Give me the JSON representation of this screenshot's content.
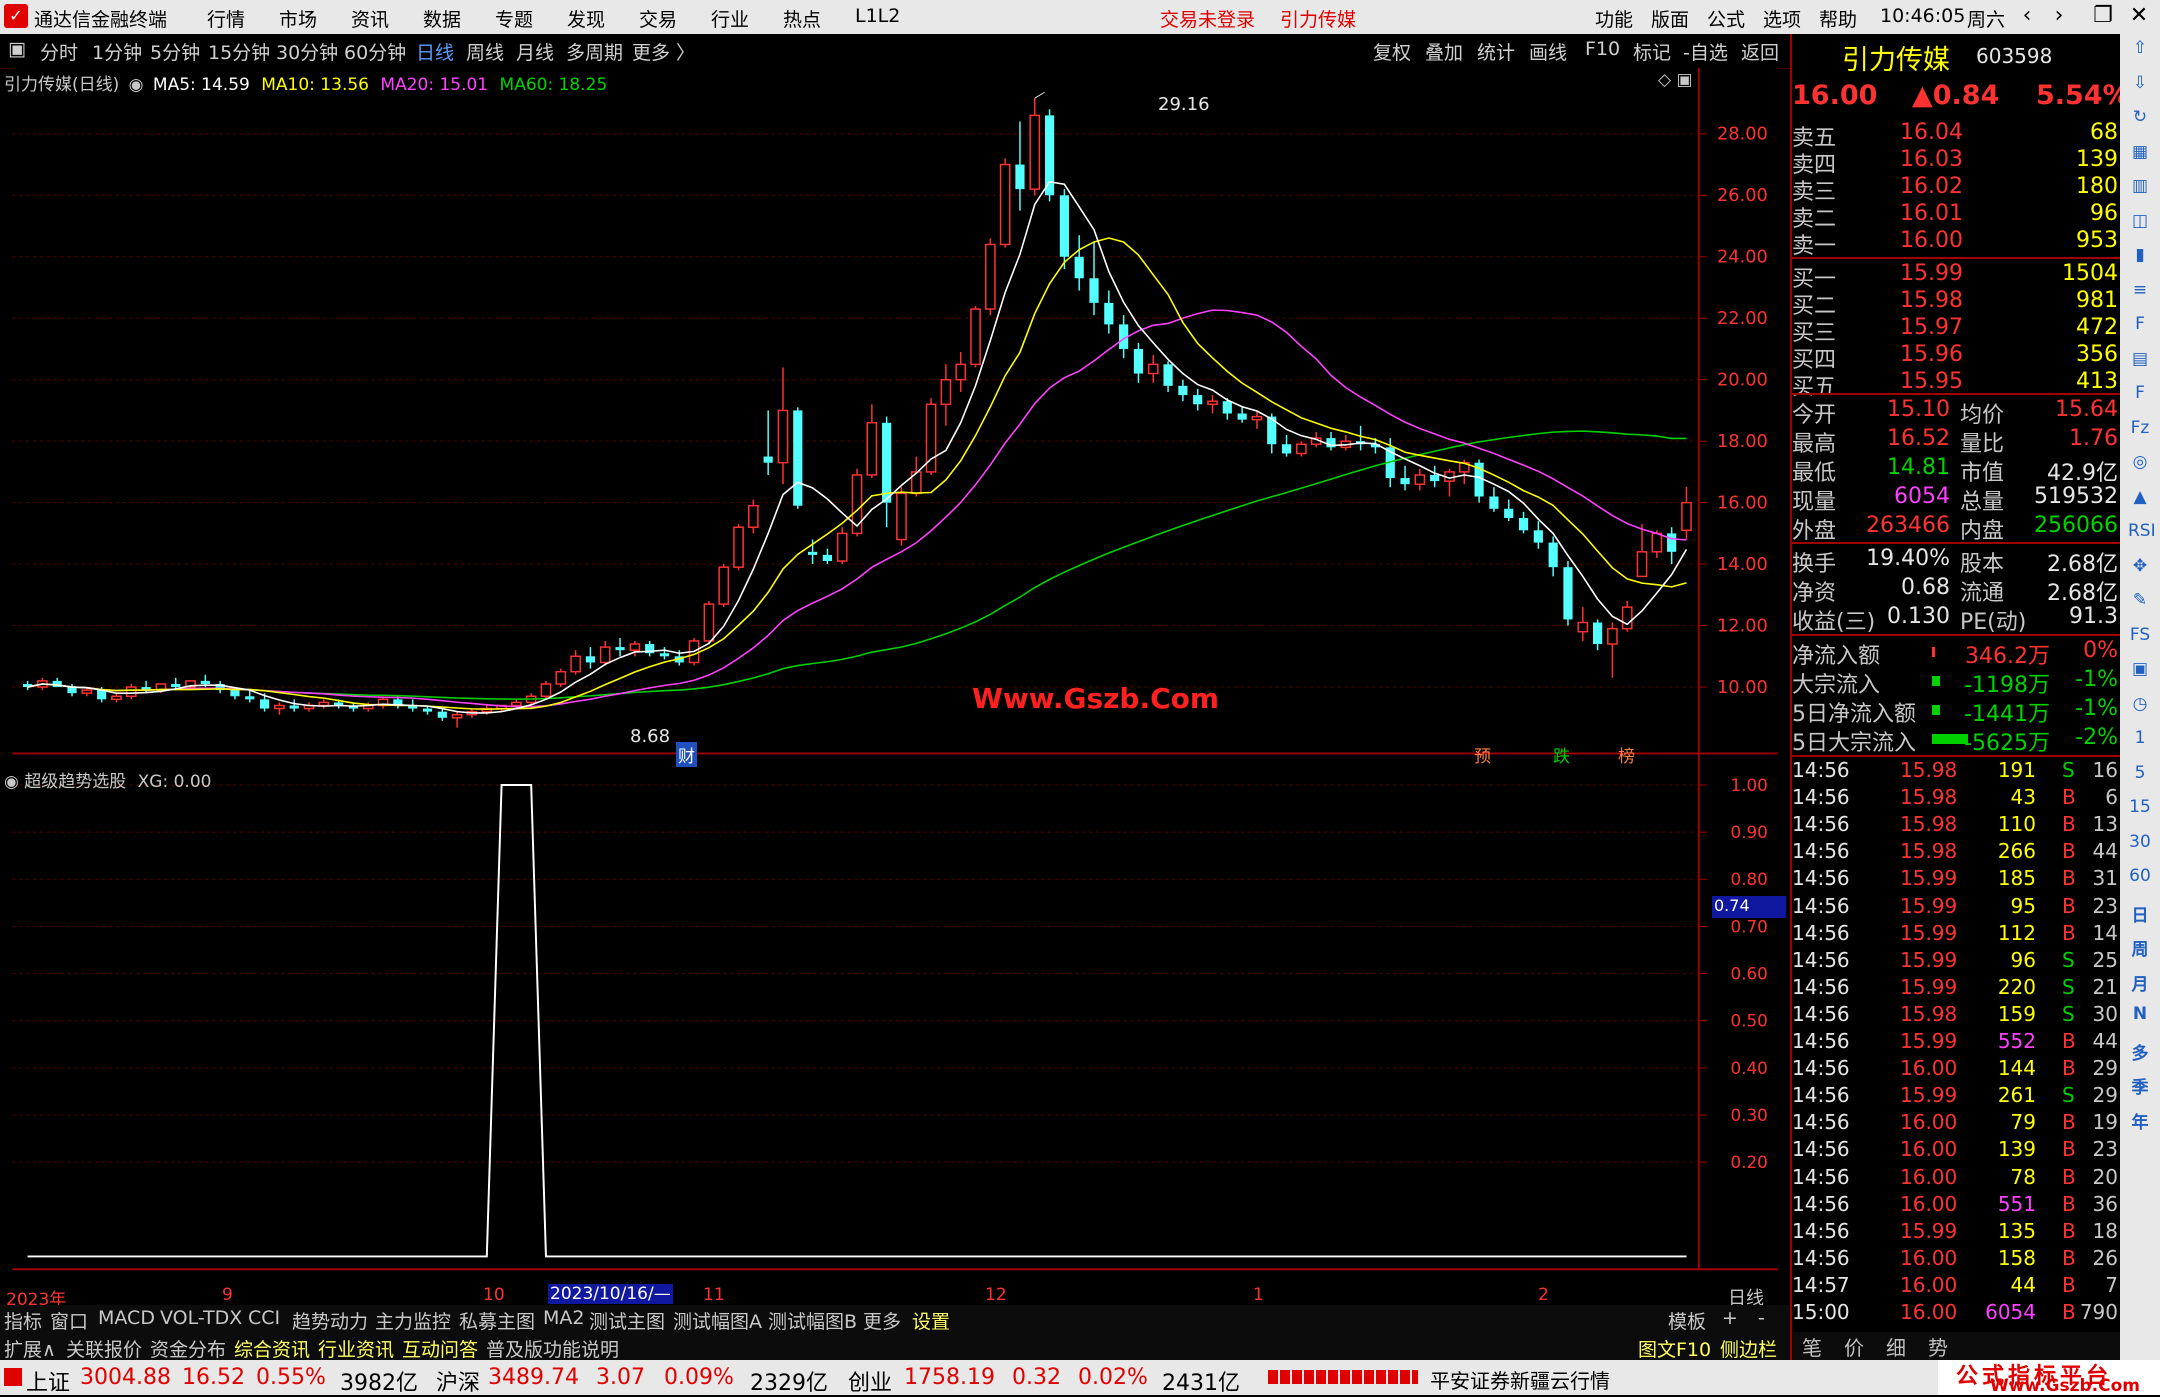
{
  "app": {
    "title": "通达信金融终端",
    "menu": [
      "行情",
      "市场",
      "资讯",
      "数据",
      "专题",
      "发现",
      "交易",
      "行业",
      "热点",
      "L1L2"
    ],
    "login_status": "交易未登录",
    "stock_name_top": "引力传媒",
    "right_menu": [
      "功能",
      "版面",
      "公式",
      "选项",
      "帮助"
    ],
    "time": "10:46:05",
    "weekday": "周六"
  },
  "periods": [
    "分时",
    "1分钟",
    "5分钟",
    "15分钟",
    "30分钟",
    "60分钟",
    "日线",
    "周线",
    "月线",
    "多周期",
    "更多 〉"
  ],
  "active_period": "日线",
  "chart_buttons": [
    "复权",
    "叠加",
    "统计",
    "画线",
    "F10",
    "标记",
    "-自选",
    "返回"
  ],
  "main_chart": {
    "title": "引力传媒(日线)",
    "ma5": "MA5: 14.59",
    "ma10": "MA10: 13.56",
    "ma20": "MA20: 15.01",
    "ma60": "MA60: 18.25",
    "high_label": "29.16",
    "low_label": "8.68",
    "watermark": "Www.Gszb.Com",
    "markers": [
      "财",
      "预",
      "跌",
      "榜"
    ],
    "colors": {
      "up": "#ff3232",
      "down": "#54ffff",
      "ma5": "#ffffff",
      "ma10": "#ffff00",
      "ma20": "#ff40ff",
      "ma60": "#00d200"
    }
  },
  "indicator_panel": {
    "title": "超级趋势选股",
    "value": "XG: 0.00",
    "cursor_value": "0.74"
  },
  "x_axis": {
    "labels": [
      "2023年",
      "9",
      "10",
      "2023/10/16/—",
      "11",
      "12",
      "1",
      "2"
    ],
    "period_label": "日线"
  },
  "chart_data": [
    {
      "type": "candlestick",
      "title": "引力传媒(日线)",
      "y_ticks": [
        "28.00",
        "26.00",
        "24.00",
        "22.00",
        "20.00",
        "18.00",
        "16.00",
        "14.00",
        "12.00",
        "10.00"
      ],
      "ylim": [
        8.0,
        29.5
      ],
      "series_names": [
        "MA5",
        "MA10",
        "MA20",
        "MA60"
      ],
      "x_months": [
        "2023年",
        "9",
        "10",
        "11",
        "12",
        "1",
        "2"
      ],
      "candles": [
        [
          10.1,
          10.2,
          9.9,
          10.0
        ],
        [
          10.0,
          10.3,
          9.9,
          10.2
        ],
        [
          10.2,
          10.3,
          10.0,
          10.0
        ],
        [
          10.0,
          10.1,
          9.7,
          9.8
        ],
        [
          9.8,
          10.0,
          9.7,
          9.9
        ],
        [
          9.9,
          10.0,
          9.5,
          9.6
        ],
        [
          9.6,
          9.8,
          9.5,
          9.7
        ],
        [
          9.7,
          10.1,
          9.6,
          10.0
        ],
        [
          10.0,
          10.2,
          9.8,
          9.9
        ],
        [
          9.9,
          10.1,
          9.8,
          10.1
        ],
        [
          10.1,
          10.3,
          9.9,
          10.0
        ],
        [
          10.0,
          10.2,
          9.9,
          10.2
        ],
        [
          10.2,
          10.4,
          10.0,
          10.1
        ],
        [
          10.1,
          10.2,
          9.8,
          9.9
        ],
        [
          9.9,
          10.0,
          9.6,
          9.7
        ],
        [
          9.7,
          9.9,
          9.5,
          9.6
        ],
        [
          9.6,
          9.8,
          9.2,
          9.3
        ],
        [
          9.3,
          9.5,
          9.1,
          9.4
        ],
        [
          9.4,
          9.6,
          9.2,
          9.3
        ],
        [
          9.3,
          9.5,
          9.2,
          9.4
        ],
        [
          9.4,
          9.6,
          9.3,
          9.5
        ],
        [
          9.5,
          9.6,
          9.3,
          9.4
        ],
        [
          9.4,
          9.5,
          9.2,
          9.3
        ],
        [
          9.3,
          9.5,
          9.2,
          9.4
        ],
        [
          9.4,
          9.7,
          9.3,
          9.6
        ],
        [
          9.6,
          9.7,
          9.3,
          9.4
        ],
        [
          9.4,
          9.6,
          9.2,
          9.3
        ],
        [
          9.3,
          9.4,
          9.1,
          9.2
        ],
        [
          9.2,
          9.3,
          8.9,
          9.0
        ],
        [
          9.0,
          9.2,
          8.68,
          9.1
        ],
        [
          9.1,
          9.3,
          9.0,
          9.2
        ],
        [
          9.2,
          9.4,
          9.1,
          9.3
        ],
        [
          9.3,
          9.4,
          9.2,
          9.4
        ],
        [
          9.4,
          9.6,
          9.3,
          9.5
        ],
        [
          9.5,
          9.8,
          9.4,
          9.7
        ],
        [
          9.7,
          10.2,
          9.6,
          10.1
        ],
        [
          10.1,
          10.6,
          10.0,
          10.5
        ],
        [
          10.5,
          11.2,
          10.4,
          11.0
        ],
        [
          11.0,
          11.3,
          10.6,
          10.8
        ],
        [
          10.8,
          11.5,
          10.7,
          11.3
        ],
        [
          11.3,
          11.6,
          11.0,
          11.2
        ],
        [
          11.2,
          11.5,
          11.0,
          11.4
        ],
        [
          11.4,
          11.5,
          11.0,
          11.1
        ],
        [
          11.1,
          11.3,
          10.9,
          11.0
        ],
        [
          11.0,
          11.2,
          10.7,
          10.8
        ],
        [
          10.8,
          11.6,
          10.7,
          11.5
        ],
        [
          11.5,
          12.8,
          11.4,
          12.7
        ],
        [
          12.7,
          14.0,
          12.6,
          13.9
        ],
        [
          13.9,
          15.3,
          13.8,
          15.2
        ],
        [
          15.2,
          16.1,
          15.0,
          15.9
        ],
        [
          17.5,
          19.0,
          16.9,
          17.3
        ],
        [
          17.3,
          20.4,
          16.6,
          19.0
        ],
        [
          19.0,
          19.1,
          15.8,
          15.9
        ],
        [
          14.4,
          14.8,
          14.0,
          14.3
        ],
        [
          14.3,
          14.5,
          14.0,
          14.1
        ],
        [
          14.1,
          15.2,
          14.0,
          15.0
        ],
        [
          15.0,
          17.1,
          14.9,
          16.9
        ],
        [
          16.9,
          19.2,
          16.8,
          18.6
        ],
        [
          18.6,
          18.8,
          15.2,
          16.0
        ],
        [
          14.8,
          16.5,
          14.6,
          16.3
        ],
        [
          16.3,
          17.5,
          16.2,
          17.0
        ],
        [
          17.0,
          19.4,
          16.9,
          19.2
        ],
        [
          19.2,
          20.5,
          18.5,
          20.0
        ],
        [
          20.0,
          20.9,
          19.6,
          20.5
        ],
        [
          20.5,
          22.4,
          20.4,
          22.3
        ],
        [
          22.3,
          24.6,
          22.1,
          24.4
        ],
        [
          24.4,
          27.2,
          24.3,
          27.0
        ],
        [
          27.0,
          28.4,
          25.5,
          26.2
        ],
        [
          26.2,
          29.16,
          26.0,
          28.6
        ],
        [
          28.6,
          28.8,
          25.8,
          26.0
        ],
        [
          26.0,
          26.2,
          23.6,
          24.0
        ],
        [
          24.0,
          24.7,
          22.9,
          23.3
        ],
        [
          23.3,
          24.5,
          22.1,
          22.5
        ],
        [
          22.5,
          22.9,
          21.5,
          21.8
        ],
        [
          21.8,
          22.1,
          20.7,
          21.0
        ],
        [
          21.0,
          21.2,
          19.9,
          20.2
        ],
        [
          20.2,
          20.8,
          19.9,
          20.5
        ],
        [
          20.5,
          20.6,
          19.6,
          19.8
        ],
        [
          19.8,
          20.0,
          19.3,
          19.5
        ],
        [
          19.5,
          19.7,
          19.0,
          19.2
        ],
        [
          19.2,
          19.5,
          18.9,
          19.3
        ],
        [
          19.3,
          19.4,
          18.7,
          18.9
        ],
        [
          18.9,
          19.1,
          18.6,
          18.7
        ],
        [
          18.7,
          19.0,
          18.4,
          18.8
        ],
        [
          18.8,
          18.9,
          17.6,
          17.9
        ],
        [
          17.9,
          18.2,
          17.5,
          17.6
        ],
        [
          17.6,
          18.0,
          17.5,
          17.9
        ],
        [
          17.9,
          18.3,
          17.8,
          18.1
        ],
        [
          18.1,
          18.3,
          17.7,
          17.8
        ],
        [
          17.8,
          18.2,
          17.7,
          18.0
        ],
        [
          18.0,
          18.5,
          17.7,
          17.9
        ],
        [
          17.9,
          18.1,
          17.6,
          17.8
        ],
        [
          17.8,
          18.1,
          16.5,
          16.8
        ],
        [
          16.8,
          17.2,
          16.4,
          16.6
        ],
        [
          16.6,
          17.1,
          16.4,
          16.9
        ],
        [
          16.9,
          17.2,
          16.5,
          16.7
        ],
        [
          16.7,
          17.1,
          16.2,
          17.0
        ],
        [
          17.0,
          17.4,
          16.6,
          17.3
        ],
        [
          17.3,
          17.4,
          16.0,
          16.2
        ],
        [
          16.2,
          16.5,
          15.7,
          15.8
        ],
        [
          15.8,
          16.1,
          15.4,
          15.5
        ],
        [
          15.5,
          15.7,
          15.0,
          15.1
        ],
        [
          15.1,
          15.4,
          14.5,
          14.7
        ],
        [
          14.7,
          14.9,
          13.6,
          13.9
        ],
        [
          13.9,
          14.1,
          12.0,
          12.2
        ],
        [
          11.8,
          12.6,
          11.5,
          12.1
        ],
        [
          12.1,
          12.2,
          11.2,
          11.4
        ],
        [
          11.4,
          12.1,
          10.3,
          11.9
        ],
        [
          11.9,
          12.8,
          11.8,
          12.6
        ],
        [
          13.6,
          15.3,
          13.6,
          14.4
        ],
        [
          14.4,
          15.1,
          14.2,
          15.0
        ],
        [
          15.0,
          15.2,
          14.0,
          14.4
        ],
        [
          15.1,
          16.52,
          14.81,
          16.0
        ]
      ]
    },
    {
      "type": "line",
      "title": "超级趋势选股",
      "series_names": [
        "XG"
      ],
      "y_ticks": [
        "1.00",
        "0.90",
        "0.80",
        "0.70",
        "0.60",
        "0.50",
        "0.40",
        "0.30",
        "0.20"
      ],
      "ylim": [
        0,
        1.0
      ],
      "values_at_candle_index": [
        [
          0,
          0
        ],
        [
          31,
          0
        ],
        [
          32,
          1
        ],
        [
          34,
          1
        ],
        [
          35,
          0
        ],
        [
          112,
          0
        ]
      ]
    }
  ],
  "quote": {
    "name": "引力传媒",
    "code": "603598",
    "price": "16.00",
    "change": "▲0.84",
    "change_pct": "5.54%",
    "asks": [
      {
        "label": "卖五",
        "price": "16.04",
        "vol": "68"
      },
      {
        "label": "卖四",
        "price": "16.03",
        "vol": "139"
      },
      {
        "label": "卖三",
        "price": "16.02",
        "vol": "180"
      },
      {
        "label": "卖二",
        "price": "16.01",
        "vol": "96"
      },
      {
        "label": "卖一",
        "price": "16.00",
        "vol": "953"
      }
    ],
    "bids": [
      {
        "label": "买一",
        "price": "15.99",
        "vol": "1504"
      },
      {
        "label": "买二",
        "price": "15.98",
        "vol": "981"
      },
      {
        "label": "买三",
        "price": "15.97",
        "vol": "472"
      },
      {
        "label": "买四",
        "price": "15.96",
        "vol": "356"
      },
      {
        "label": "买五",
        "price": "15.95",
        "vol": "413"
      }
    ],
    "stats": [
      {
        "l1": "今开",
        "v1": "15.10",
        "l2": "均价",
        "v2": "15.64",
        "c1": "red",
        "c2": "red"
      },
      {
        "l1": "最高",
        "v1": "16.52",
        "l2": "量比",
        "v2": "1.76",
        "c1": "red",
        "c2": "red"
      },
      {
        "l1": "最低",
        "v1": "14.81",
        "l2": "市值",
        "v2": "42.9亿",
        "c1": "green",
        "c2": "white"
      },
      {
        "l1": "现量",
        "v1": "6054",
        "l2": "总量",
        "v2": "519532",
        "c1": "magenta",
        "c2": "white"
      },
      {
        "l1": "外盘",
        "v1": "263466",
        "l2": "内盘",
        "v2": "256066",
        "c1": "red",
        "c2": "green"
      }
    ],
    "stats2": [
      {
        "l1": "换手",
        "v1": "19.40%",
        "l2": "股本",
        "v2": "2.68亿"
      },
      {
        "l1": "净资",
        "v1": "0.68",
        "l2": "流通",
        "v2": "2.68亿"
      },
      {
        "l1": "收益(三)",
        "v1": "0.130",
        "l2": "PE(动)",
        "v2": "91.3"
      }
    ],
    "flows": [
      {
        "label": "净流入额",
        "value": "346.2万",
        "pct": "0%",
        "color": "red"
      },
      {
        "label": "大宗流入",
        "value": "-1198万",
        "pct": "-1%",
        "color": "green"
      },
      {
        "label": "5日净流入额",
        "value": "-1441万",
        "pct": "-1%",
        "color": "green"
      },
      {
        "label": "5日大宗流入",
        "value": "-5625万",
        "pct": "-2%",
        "color": "green"
      }
    ],
    "ticks": [
      {
        "t": "14:56",
        "p": "15.98",
        "v": "191",
        "s": "S",
        "n": "16"
      },
      {
        "t": "14:56",
        "p": "15.98",
        "v": "43",
        "s": "B",
        "n": "6"
      },
      {
        "t": "14:56",
        "p": "15.98",
        "v": "110",
        "s": "B",
        "n": "13"
      },
      {
        "t": "14:56",
        "p": "15.98",
        "v": "266",
        "s": "B",
        "n": "44"
      },
      {
        "t": "14:56",
        "p": "15.99",
        "v": "185",
        "s": "B",
        "n": "31"
      },
      {
        "t": "14:56",
        "p": "15.99",
        "v": "95",
        "s": "B",
        "n": "23"
      },
      {
        "t": "14:56",
        "p": "15.99",
        "v": "112",
        "s": "B",
        "n": "14"
      },
      {
        "t": "14:56",
        "p": "15.99",
        "v": "96",
        "s": "S",
        "n": "25"
      },
      {
        "t": "14:56",
        "p": "15.99",
        "v": "220",
        "s": "S",
        "n": "21"
      },
      {
        "t": "14:56",
        "p": "15.98",
        "v": "159",
        "s": "S",
        "n": "30"
      },
      {
        "t": "14:56",
        "p": "15.99",
        "v": "552",
        "s": "B",
        "n": "44"
      },
      {
        "t": "14:56",
        "p": "16.00",
        "v": "144",
        "s": "B",
        "n": "29"
      },
      {
        "t": "14:56",
        "p": "15.99",
        "v": "261",
        "s": "S",
        "n": "29"
      },
      {
        "t": "14:56",
        "p": "16.00",
        "v": "79",
        "s": "B",
        "n": "19"
      },
      {
        "t": "14:56",
        "p": "16.00",
        "v": "139",
        "s": "B",
        "n": "23"
      },
      {
        "t": "14:56",
        "p": "16.00",
        "v": "78",
        "s": "B",
        "n": "20"
      },
      {
        "t": "14:56",
        "p": "16.00",
        "v": "551",
        "s": "B",
        "n": "36"
      },
      {
        "t": "14:56",
        "p": "15.99",
        "v": "135",
        "s": "B",
        "n": "18"
      },
      {
        "t": "14:56",
        "p": "16.00",
        "v": "158",
        "s": "B",
        "n": "26"
      },
      {
        "t": "14:57",
        "p": "16.00",
        "v": "44",
        "s": "B",
        "n": "7"
      },
      {
        "t": "15:00",
        "p": "16.00",
        "v": "6054",
        "s": "B",
        "n": "790"
      }
    ],
    "bottom_tabs": [
      "笔",
      "价",
      "细",
      "势"
    ]
  },
  "tabs1": [
    "指标",
    "窗口",
    "MACD",
    "VOL-TDX",
    "CCI",
    "趋势动力",
    "主力监控",
    "私募主图",
    "MA2",
    "测试主图",
    "测试幅图A",
    "测试幅图B",
    "更多",
    "设置",
    "模板",
    "+",
    "-"
  ],
  "tabs2": [
    "扩展∧",
    "关联报价",
    "资金分布",
    "综合资讯",
    "行业资讯",
    "互动问答",
    "普及版功能说明",
    "图文F10",
    "侧边栏《"
  ],
  "status": {
    "sh_name": "上证",
    "sh_val": "3004.88",
    "sh_chg": "16.52",
    "sh_pct": "0.55%",
    "sh_amt": "3982亿",
    "sz_name": "沪深",
    "sz_val": "3489.74",
    "sz_chg": "3.07",
    "sz_pct": "0.09%",
    "sz_amt": "2329亿",
    "cy_name": "创业",
    "cy_val": "1758.19",
    "cy_chg": "0.32",
    "cy_pct": "0.02%",
    "cy_amt": "2431亿",
    "broker": "平安证券新疆云行情",
    "logo_line1": "公式指标平台",
    "logo_line2": "Www.Gszb.Com"
  },
  "sidebar_icons": [
    "arrow-up-icon",
    "arrow-down-icon",
    "refresh-icon",
    "grid-icon",
    "grid2-icon",
    "line-chart-icon",
    "candle-icon",
    "list-icon",
    "f10-icon",
    "table-icon",
    "f-icon",
    "fz-icon",
    "ring-icon",
    "chart-icon",
    "rsi-icon",
    "move-icon",
    "pen-icon",
    "fs-icon",
    "win-icon",
    "clock-icon",
    "1-icon",
    "5-icon",
    "15-icon",
    "30-icon",
    "60-icon",
    "日",
    "周",
    "月",
    "N",
    "多",
    "季",
    "年"
  ]
}
